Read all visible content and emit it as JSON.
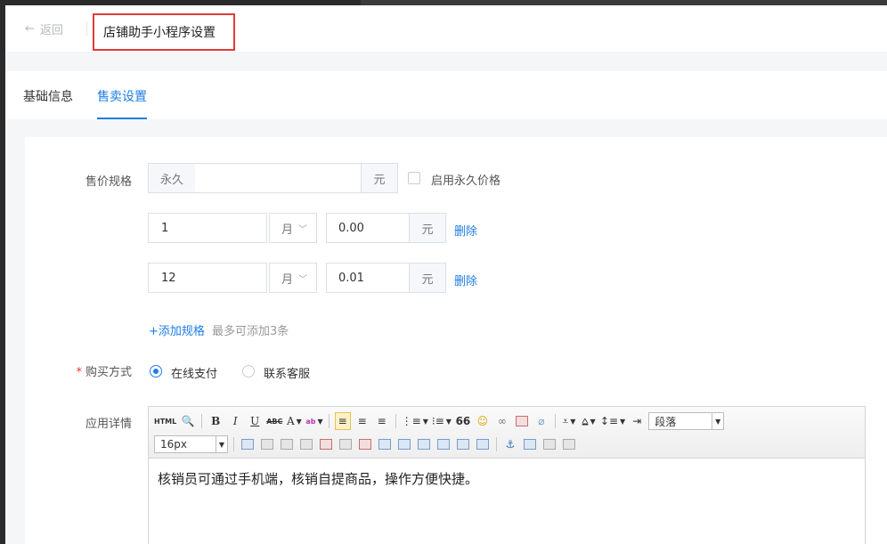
{
  "header": {
    "back_label": "返回",
    "back_icon": "arrow-left-icon",
    "title": "店铺助手小程序设置"
  },
  "tabs": [
    {
      "label": "基础信息",
      "active": false
    },
    {
      "label": "售卖设置",
      "active": true
    }
  ],
  "form": {
    "price_spec": {
      "label": "售价规格",
      "permanent": {
        "prefix": "永久",
        "value": "",
        "suffix": "元"
      },
      "enable_permanent_label": "启用永久价格",
      "enable_permanent_checked": false,
      "rows": [
        {
          "duration": "1",
          "unit": "月",
          "price": "0.00",
          "currency": "元",
          "delete_label": "删除"
        },
        {
          "duration": "12",
          "unit": "月",
          "price": "0.01",
          "currency": "元",
          "delete_label": "删除"
        }
      ],
      "add_label": "+添加规格",
      "add_hint": "最多可添加3条"
    },
    "purchase": {
      "required_mark": "*",
      "label": "购买方式",
      "options": [
        {
          "label": "在线支付",
          "checked": true
        },
        {
          "label": "联系客服",
          "checked": false
        }
      ]
    },
    "detail": {
      "label": "应用详情",
      "toolbar": {
        "html_label": "HTML",
        "bold": "B",
        "italic": "I",
        "underline": "U",
        "strike": "ABC",
        "font_color": "A",
        "highlight": "ab",
        "quote": "66",
        "paragraph_select": "段落",
        "font_size_select": "16px"
      },
      "content": "核销员可通过手机端，核销自提商品，操作方便快捷。"
    }
  },
  "colors": {
    "accent": "#1f7de6",
    "highlight_border": "#e23a3a",
    "required": "#e23a3a"
  }
}
